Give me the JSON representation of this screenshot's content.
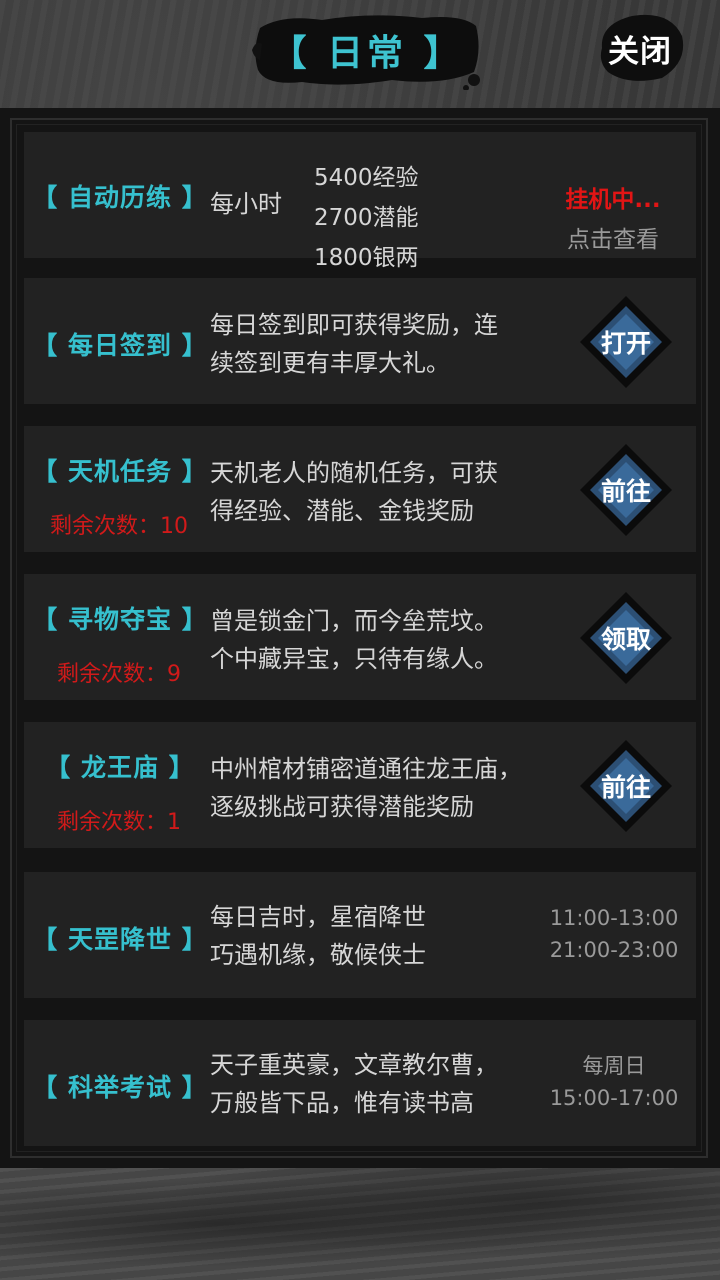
{
  "header": {
    "title": "【 日常 】",
    "close_label": "关闭"
  },
  "auto_training": {
    "name": "【 自动历练 】",
    "per_hour_label": "每小时",
    "rewards": [
      "5400经验",
      "2700潜能",
      "1800银两"
    ],
    "status": "挂机中...",
    "view_label": "点击查看"
  },
  "daily_signin": {
    "name": "【 每日签到 】",
    "desc_line1": "每日签到即可获得奖励，连",
    "desc_line2": "续签到更有丰厚大礼。",
    "button_label": "打开"
  },
  "tianji_task": {
    "name": "【 天机任务 】",
    "remaining": "剩余次数：10",
    "desc_line1": "天机老人的随机任务，可获",
    "desc_line2": "得经验、潜能、金钱奖励",
    "button_label": "前往"
  },
  "treasure_hunt": {
    "name": "【 寻物夺宝 】",
    "remaining": "剩余次数：9",
    "desc_line1": "曾是锁金门，而今垒荒坟。",
    "desc_line2": "个中藏异宝，只待有缘人。",
    "button_label": "领取"
  },
  "dragon_temple": {
    "name": "【 龙王庙 】",
    "remaining": "剩余次数：1",
    "desc_line1": "中州棺材铺密道通往龙王庙，",
    "desc_line2": "逐级挑战可获得潜能奖励",
    "button_label": "前往"
  },
  "star_descend": {
    "name": "【 天罡降世 】",
    "desc_line1": "每日吉时，星宿降世",
    "desc_line2": "巧遇机缘，敬候侠士",
    "time_line1": "11:00-13:00",
    "time_line2": "21:00-23:00"
  },
  "imperial_exam": {
    "name": "【 科举考试 】",
    "desc_line1": "天子重英豪，文章教尔曹，",
    "desc_line2": "万般皆下品，惟有读书高",
    "time_line1": "每周日",
    "time_line2": "15:00-17:00"
  },
  "colors": {
    "accent_cyan": "#36c0ce",
    "alert_red": "#d11a1a",
    "button_blue": "#3a6a9a"
  }
}
